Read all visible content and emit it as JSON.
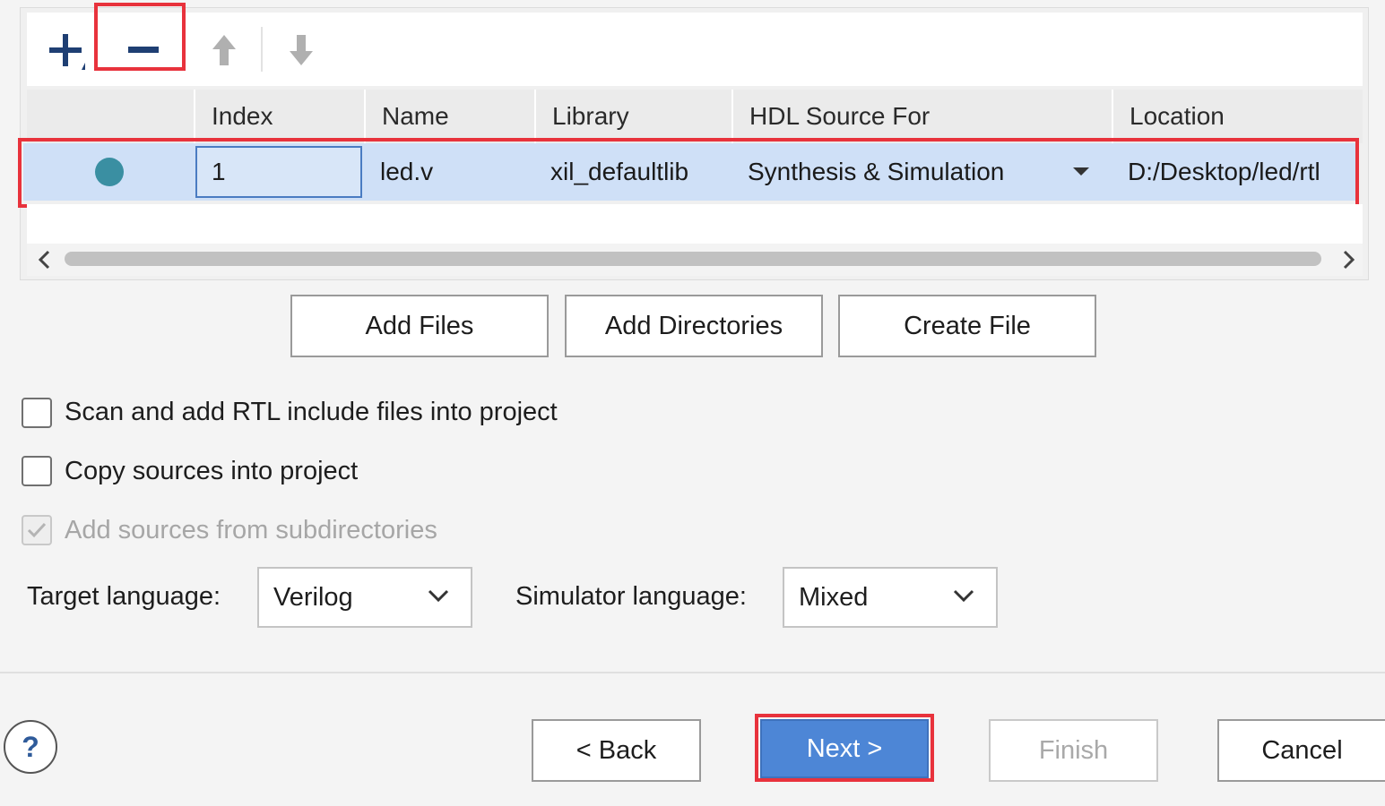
{
  "table": {
    "columns": [
      "",
      "Index",
      "Name",
      "Library",
      "HDL Source For",
      "Location"
    ],
    "rows": [
      {
        "index": "1",
        "name": "led.v",
        "library": "xil_defaultlib",
        "hdl_source_for": "Synthesis & Simulation",
        "location": "D:/Desktop/led/rtl"
      }
    ]
  },
  "toolbar": {
    "add_icon": "plus-icon",
    "remove_icon": "minus-icon",
    "up_icon": "arrow-up-icon",
    "down_icon": "arrow-down-icon"
  },
  "buttons": {
    "add_files": "Add Files",
    "add_directories": "Add Directories",
    "create_file": "Create File"
  },
  "options": {
    "scan_rtl": {
      "label": "Scan and add RTL include files into project",
      "checked": false
    },
    "copy_sources": {
      "label": "Copy sources into project",
      "checked": false
    },
    "add_subdirs": {
      "label": "Add sources from subdirectories",
      "checked": true,
      "disabled": true
    }
  },
  "languages": {
    "target_label": "Target language:",
    "target_value": "Verilog",
    "simulator_label": "Simulator language:",
    "simulator_value": "Mixed"
  },
  "footer": {
    "help": "?",
    "back": "< Back",
    "next": "Next >",
    "finish": "Finish",
    "cancel": "Cancel"
  },
  "colors": {
    "highlight_red": "#e8323c",
    "row_selected": "#cfe0f7",
    "primary_button": "#4d86d6",
    "status_dot": "#3a8fa2"
  }
}
